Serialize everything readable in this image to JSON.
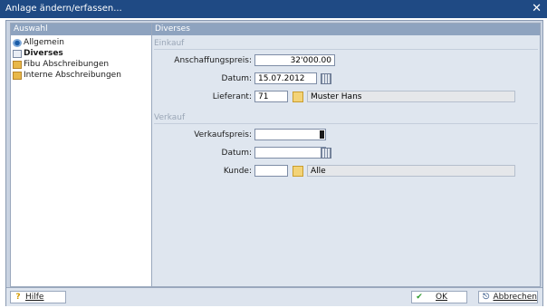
{
  "window": {
    "title": "Anlage ändern/erfassen...",
    "close_glyph": "✕"
  },
  "left_panel": {
    "header": "Auswahl",
    "items": [
      {
        "label": "Allgemein",
        "icon": "gear-icon",
        "selected": false
      },
      {
        "label": "Diverses",
        "icon": "document-icon",
        "selected": true
      },
      {
        "label": "Fibu Abschreibungen",
        "icon": "folder-icon",
        "selected": false
      },
      {
        "label": "Interne Abschreibungen",
        "icon": "folder-icon",
        "selected": false
      }
    ]
  },
  "right_panel": {
    "header": "Diverses",
    "einkauf": {
      "title": "Einkauf",
      "anschaffungspreis_label": "Anschaffungspreis:",
      "anschaffungspreis_value": "32'000.00",
      "datum_label": "Datum:",
      "datum_value": "15.07.2012",
      "lieferant_label": "Lieferant:",
      "lieferant_code": "71",
      "lieferant_name": "Muster Hans"
    },
    "verkauf": {
      "title": "Verkauf",
      "verkaufspreis_label": "Verkaufspreis:",
      "verkaufspreis_value": "",
      "datum_label": "Datum:",
      "datum_value": "",
      "kunde_label": "Kunde:",
      "kunde_code": "",
      "kunde_name": "Alle"
    }
  },
  "footer": {
    "help_label": "Hilfe",
    "ok_label": "OK",
    "cancel_label": "Abbrechen",
    "help_glyph": "?",
    "ok_glyph": "✔",
    "cancel_glyph": "⎋"
  },
  "colors": {
    "titlebar": "#1f4a84",
    "panel_header": "#8ea3bf",
    "frame": "#c9d3e1"
  }
}
